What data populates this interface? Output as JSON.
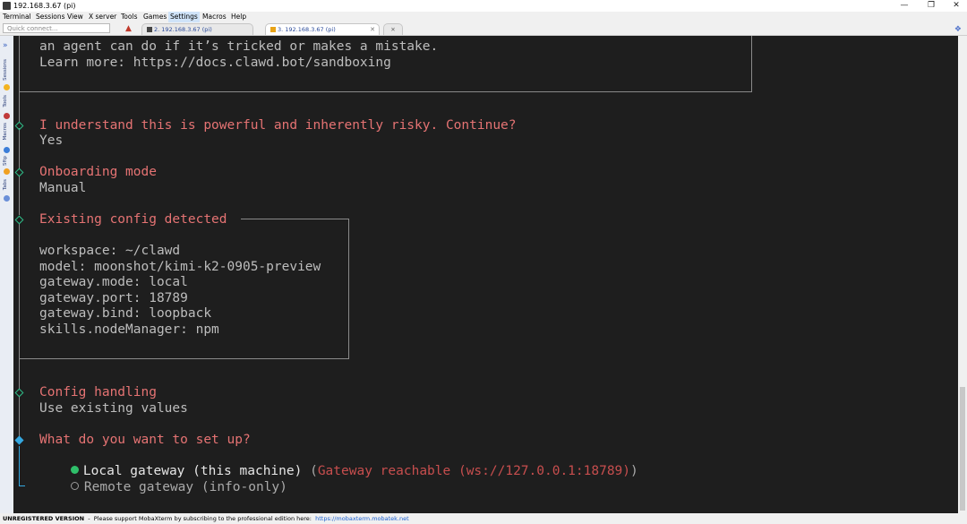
{
  "window": {
    "title": "192.168.3.67 (pi)"
  },
  "menu": [
    "Terminal",
    "Sessions",
    "View",
    "X server",
    "Tools",
    "Games",
    "Settings",
    "Macros",
    "Help"
  ],
  "quick_connect": {
    "placeholder": "Quick connect..."
  },
  "tabs": [
    {
      "label": "2. 192.168.3.67 (pi)",
      "active": false
    },
    {
      "label": "3. 192.168.3.67 (pi)",
      "active": true
    }
  ],
  "sidebar": [
    "Sessions",
    "Tools",
    "Macros",
    "Sftp",
    "Tabs"
  ],
  "terminal": {
    "intro_lines": [
      "an agent can do if it’s tricked or makes a mistake.",
      "Learn more: https://docs.clawd.bot/sandboxing"
    ],
    "confirm": {
      "question": "I understand this is powerful and inherently risky. Continue?",
      "answer": "Yes"
    },
    "onboarding": {
      "label": "Onboarding mode",
      "value": "Manual"
    },
    "existing_config": {
      "title": "Existing config detected",
      "lines": [
        "workspace: ~/clawd",
        "model: moonshot/kimi-k2-0905-preview",
        "gateway.mode: local",
        "gateway.port: 18789",
        "gateway.bind: loopback",
        "skills.nodeManager: npm"
      ]
    },
    "config_handling": {
      "label": "Config handling",
      "value": "Use existing values"
    },
    "setup": {
      "question": "What do you want to set up?",
      "option_local": "Local gateway (this machine)",
      "option_local_open": " (",
      "option_local_hint": "Gateway reachable (ws://127.0.0.1:18789)",
      "option_local_close": ")",
      "option_remote": "Remote gateway (info-only)"
    }
  },
  "status": {
    "unregistered": "UNREGISTERED VERSION",
    "message": "  -  Please support MobaXterm by subscribing to the professional edition here:  ",
    "link": "https://mobaxterm.mobatek.net"
  },
  "colors": {
    "prompt_red": "#e57373",
    "radio_selected": "#2fbf6a",
    "active_step": "#35a8e0"
  }
}
